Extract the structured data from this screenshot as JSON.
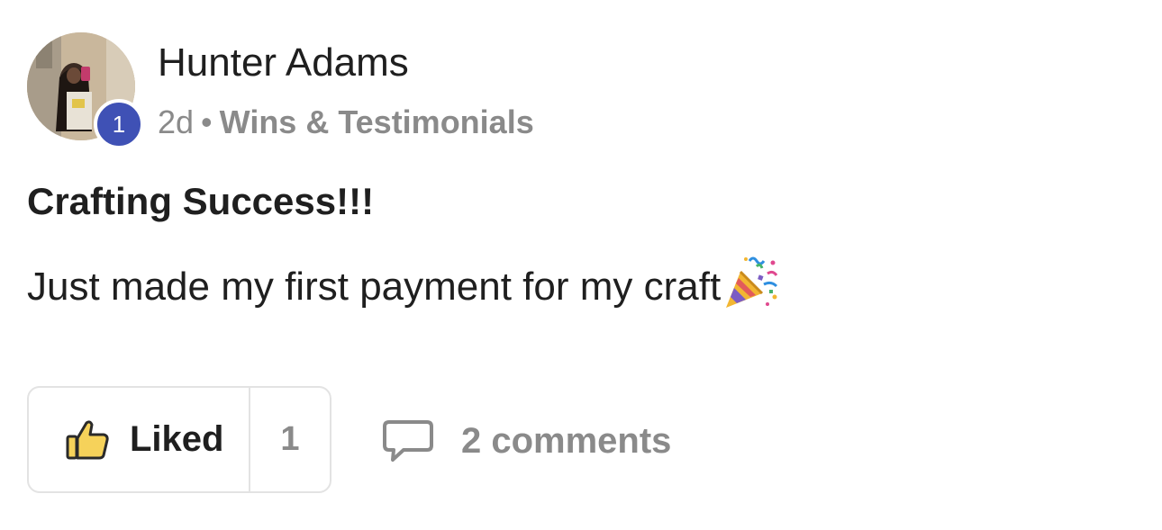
{
  "author": {
    "name": "Hunter Adams",
    "level": "1",
    "avatar": "profile-photo"
  },
  "meta": {
    "time_ago": "2d",
    "separator": "•",
    "category": "Wins & Testimonials"
  },
  "post": {
    "title": "Crafting Success!!!",
    "body": "Just made my first payment for my craft",
    "emoji": "party-popper-icon"
  },
  "actions": {
    "like_label": "Liked",
    "like_count": "1",
    "like_icon": "thumbs-up-icon",
    "comments_label": "2 comments",
    "comments_icon": "comment-bubble-icon"
  },
  "colors": {
    "badge": "#3f51b5",
    "muted_text": "#8a8a8a",
    "primary_text": "#1f1f1f",
    "border": "#e3e3e3",
    "thumb_fill": "#f6d25a"
  }
}
